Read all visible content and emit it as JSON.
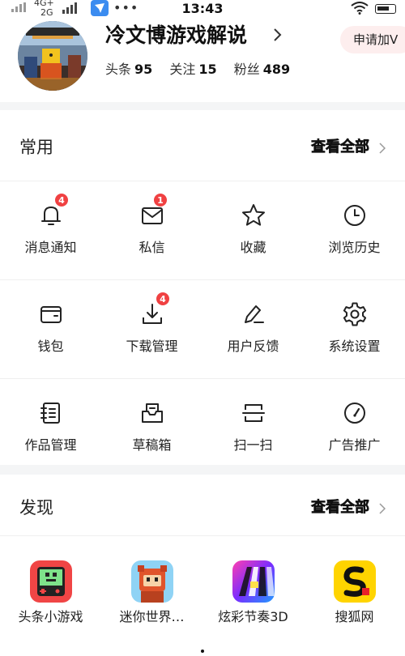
{
  "status_bar": {
    "network_top": "4G+",
    "network_bottom": "2G",
    "time": "13:43",
    "dots": "•••"
  },
  "profile": {
    "username": "冷文博游戏解说",
    "stats": [
      {
        "label": "头条",
        "value": "95"
      },
      {
        "label": "关注",
        "value": "15"
      },
      {
        "label": "粉丝",
        "value": "489"
      }
    ],
    "apply_label": "申请加V"
  },
  "common": {
    "title": "常用",
    "view_all": "查看全部",
    "items": [
      {
        "label": "消息通知",
        "icon": "bell-icon",
        "badge": "4"
      },
      {
        "label": "私信",
        "icon": "mail-icon",
        "badge": "1"
      },
      {
        "label": "收藏",
        "icon": "star-icon",
        "badge": ""
      },
      {
        "label": "浏览历史",
        "icon": "clock-icon",
        "badge": ""
      },
      {
        "label": "钱包",
        "icon": "wallet-icon",
        "badge": ""
      },
      {
        "label": "下载管理",
        "icon": "download-icon",
        "badge": "4"
      },
      {
        "label": "用户反馈",
        "icon": "pen-icon",
        "badge": ""
      },
      {
        "label": "系统设置",
        "icon": "gear-icon",
        "badge": ""
      },
      {
        "label": "作品管理",
        "icon": "notebook-icon",
        "badge": ""
      },
      {
        "label": "草稿箱",
        "icon": "inbox-icon",
        "badge": ""
      },
      {
        "label": "扫一扫",
        "icon": "scan-icon",
        "badge": ""
      },
      {
        "label": "广告推广",
        "icon": "gauge-icon",
        "badge": ""
      }
    ]
  },
  "discover": {
    "title": "发现",
    "view_all": "查看全部",
    "apps": [
      {
        "label": "头条小游戏",
        "icon": "game-console-icon"
      },
      {
        "label": "迷你世界…",
        "icon": "mini-world-icon"
      },
      {
        "label": "炫彩节奏3D",
        "icon": "rhythm-tiles-icon"
      },
      {
        "label": "搜狐网",
        "icon": "sohu-logo-icon"
      }
    ]
  },
  "colors": {
    "badge": "#f04142",
    "apply_bg": "#fdeeee",
    "page_bg": "#f4f5f6"
  }
}
